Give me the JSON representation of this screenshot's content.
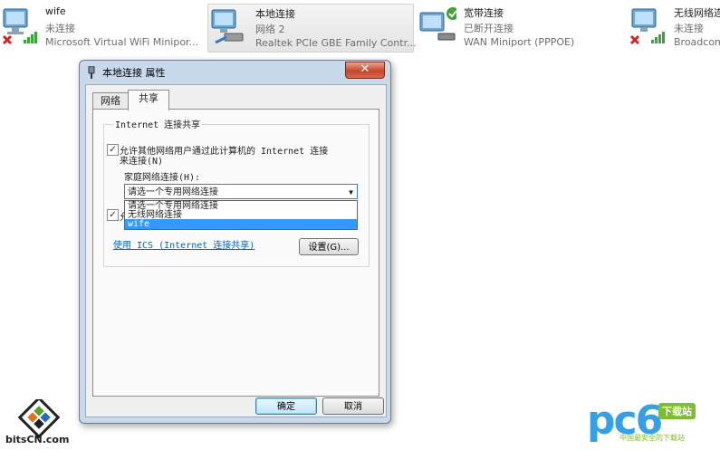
{
  "connections": [
    {
      "name": "wife",
      "status": "未连接",
      "device": "Microsoft Virtual WiFi Minipor..."
    },
    {
      "name": "本地连接",
      "status": "网络  2",
      "device": "Realtek PCIe GBE Family Contr..."
    },
    {
      "name": "宽带连接",
      "status": "已断开连接",
      "device": "WAN Miniport (PPPOE)"
    },
    {
      "name": "无线网络连",
      "status": "未连接",
      "device": "Broadcom"
    }
  ],
  "dialog": {
    "title": "本地连接 属性",
    "close_label": "✕",
    "tabs": [
      "网络",
      "共享"
    ],
    "group_label": "Internet 连接共享",
    "allow_share_label_1": "允许其他网络用户通过此计算机的 Internet 连接",
    "allow_share_label_2": "来连接(N)",
    "allow_share_checked": true,
    "home_network_label": "家庭网络连接(H):",
    "select_value": "请选一个专用网络连接",
    "dropdown_options": [
      "请选一个专用网络连接",
      "无线网络连接",
      "wife"
    ],
    "dropdown_highlighted": 2,
    "second_checkbox_checked": true,
    "second_checkbox_partial": "允",
    "ics_link": "使用 ICS (Internet 连接共享)",
    "settings_button": "设置(G)...",
    "ok_button": "确定",
    "cancel_button": "取消"
  },
  "watermarks": {
    "left": "bitsCN.com",
    "right": "pc6",
    "right_tag": "下载站",
    "right_sub": "中国最安全的下载站"
  },
  "colors": {
    "accent": "#3399ff",
    "link": "#0066cc",
    "error_x": "#d42525",
    "ok_check": "#3aa635",
    "signal": "#3aa635"
  },
  "icons": [
    "network-adapter-icon",
    "red-x-icon",
    "signal-bars-icon",
    "cable-plug-icon",
    "green-check-icon",
    "modem-icon"
  ]
}
